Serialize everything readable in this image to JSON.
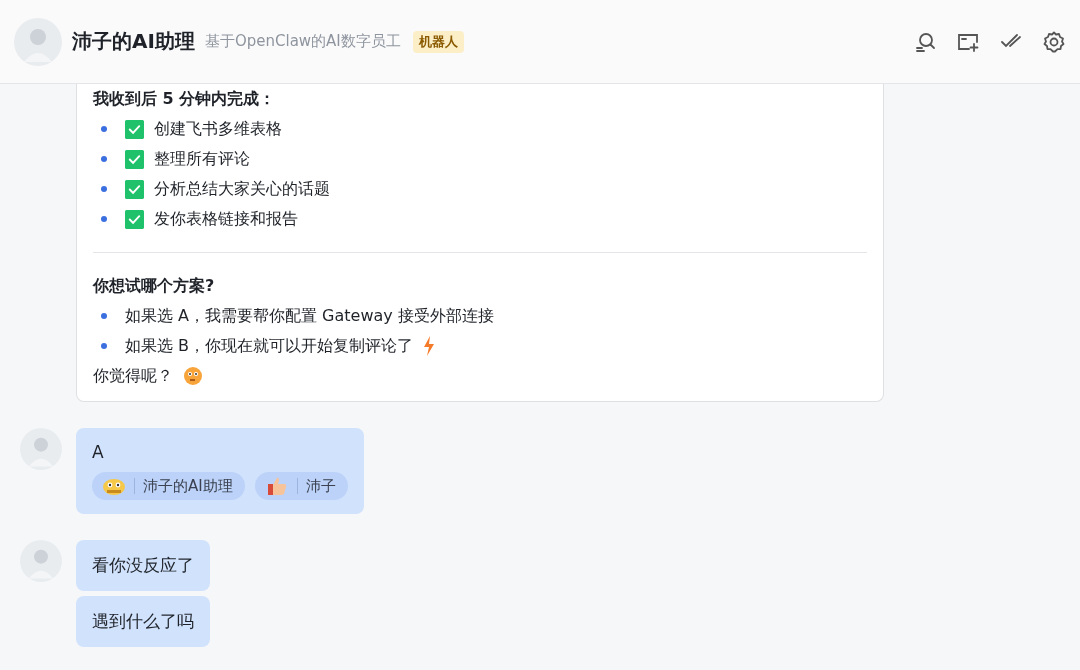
{
  "header": {
    "title": "沛子的AI助理",
    "subtitle": "基于OpenClaw的AI数字员工",
    "badge": "机器人"
  },
  "card": {
    "heading": "我收到后 5 分钟内完成：",
    "tasks": [
      {
        "text": "创建飞书多维表格",
        "checked": true
      },
      {
        "text": "整理所有评论",
        "checked": true
      },
      {
        "text": "分析总结大家关心的话题",
        "checked": true
      },
      {
        "text": "发你表格链接和报告",
        "checked": true
      }
    ],
    "question": "你想试哪个方案?",
    "options": [
      {
        "text": "如果选 A，我需要帮你配置 Gateway 接受外部连接",
        "kind": "plain"
      },
      {
        "text": "如果选 B，你现在就可以开始复制评论了",
        "kind": "flash"
      }
    ],
    "closing": "你觉得呢？"
  },
  "messages": [
    {
      "bubbles": [
        "A"
      ],
      "reactions": [
        {
          "kind": "face",
          "name": "沛子的AI助理"
        },
        {
          "kind": "thumbs",
          "name": "沛子"
        }
      ]
    },
    {
      "bubbles": [
        "看你没反应了",
        "遇到什么了吗"
      ]
    }
  ]
}
